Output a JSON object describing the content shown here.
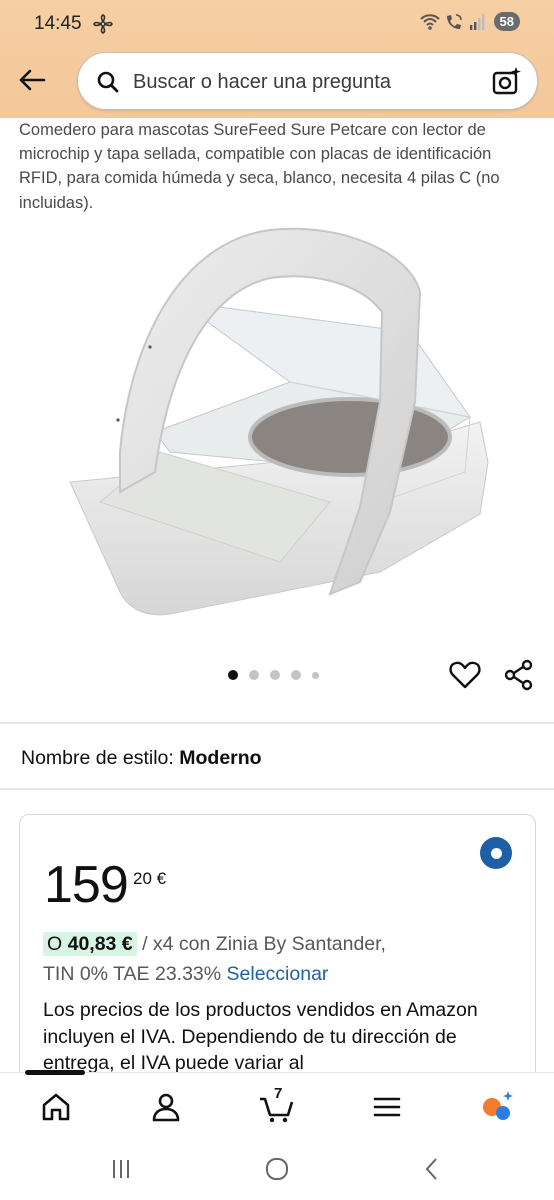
{
  "status_bar": {
    "time": "14:45",
    "battery": "58",
    "icons": [
      "pinwheel-icon",
      "wifi-icon",
      "wifi-call-icon",
      "signal-icon"
    ]
  },
  "header": {
    "search_placeholder": "Buscar o hacer una pregunta",
    "icons": [
      "back-arrow-icon",
      "search-icon",
      "camera-search-icon"
    ]
  },
  "product": {
    "title": "Comedero para mascotas SureFeed Sure Petcare con lector de microchip y tapa sellada, compatible con placas de identificación RFID, para comida húmeda y seca, blanco, necesita 4 pilas C (no incluidas).",
    "image_count": 5,
    "active_image": 1
  },
  "style": {
    "label": "Nombre de estilo:",
    "value": "Moderno"
  },
  "price": {
    "whole": "159",
    "fraction": "20 €",
    "installment_prefix": "O",
    "installment_amount": "40,83 €",
    "installment_suffix": "/ x4 con Zinia By Santander,",
    "rate_text": "TIN 0% TAE 23.33%",
    "select_link": "Seleccionar",
    "vat_note": "Los precios de los productos vendidos en Amazon incluyen el IVA. Dependiendo de tu dirección de entrega, el IVA puede variar al"
  },
  "bottom_nav": {
    "cart_count": "7",
    "items": [
      "home-icon",
      "account-icon",
      "cart-icon",
      "menu-icon",
      "rufus-assistant-icon"
    ]
  },
  "colors": {
    "header_bg": "#f3c79a",
    "link": "#2162a1",
    "radio": "#1f5fa8",
    "badge_bg": "#d7f4e2"
  }
}
